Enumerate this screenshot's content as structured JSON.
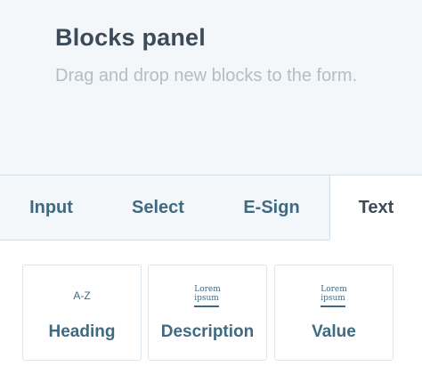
{
  "panel": {
    "title": "Blocks panel",
    "subtitle": "Drag and drop new blocks to the form."
  },
  "tabs": [
    {
      "label": "Input",
      "active": false
    },
    {
      "label": "Select",
      "active": false
    },
    {
      "label": "E-Sign",
      "active": false
    },
    {
      "label": "Text",
      "active": true
    }
  ],
  "blocks": [
    {
      "label": "Heading",
      "icon": "heading-az-icon",
      "icon_text": "A-Z"
    },
    {
      "label": "Description",
      "icon": "lorem-paragraph-icon",
      "icon_line1": "Lorem",
      "icon_line2": "ipsum"
    },
    {
      "label": "Value",
      "icon": "lorem-paragraph-icon",
      "icon_line1": "Lorem",
      "icon_line2": "ipsum"
    }
  ],
  "colors": {
    "header_bg": "#f3f7fa",
    "title": "#3d4a57",
    "subtitle": "#b4bdc5",
    "accent": "#3f6a82",
    "border": "#d3e0e8"
  }
}
